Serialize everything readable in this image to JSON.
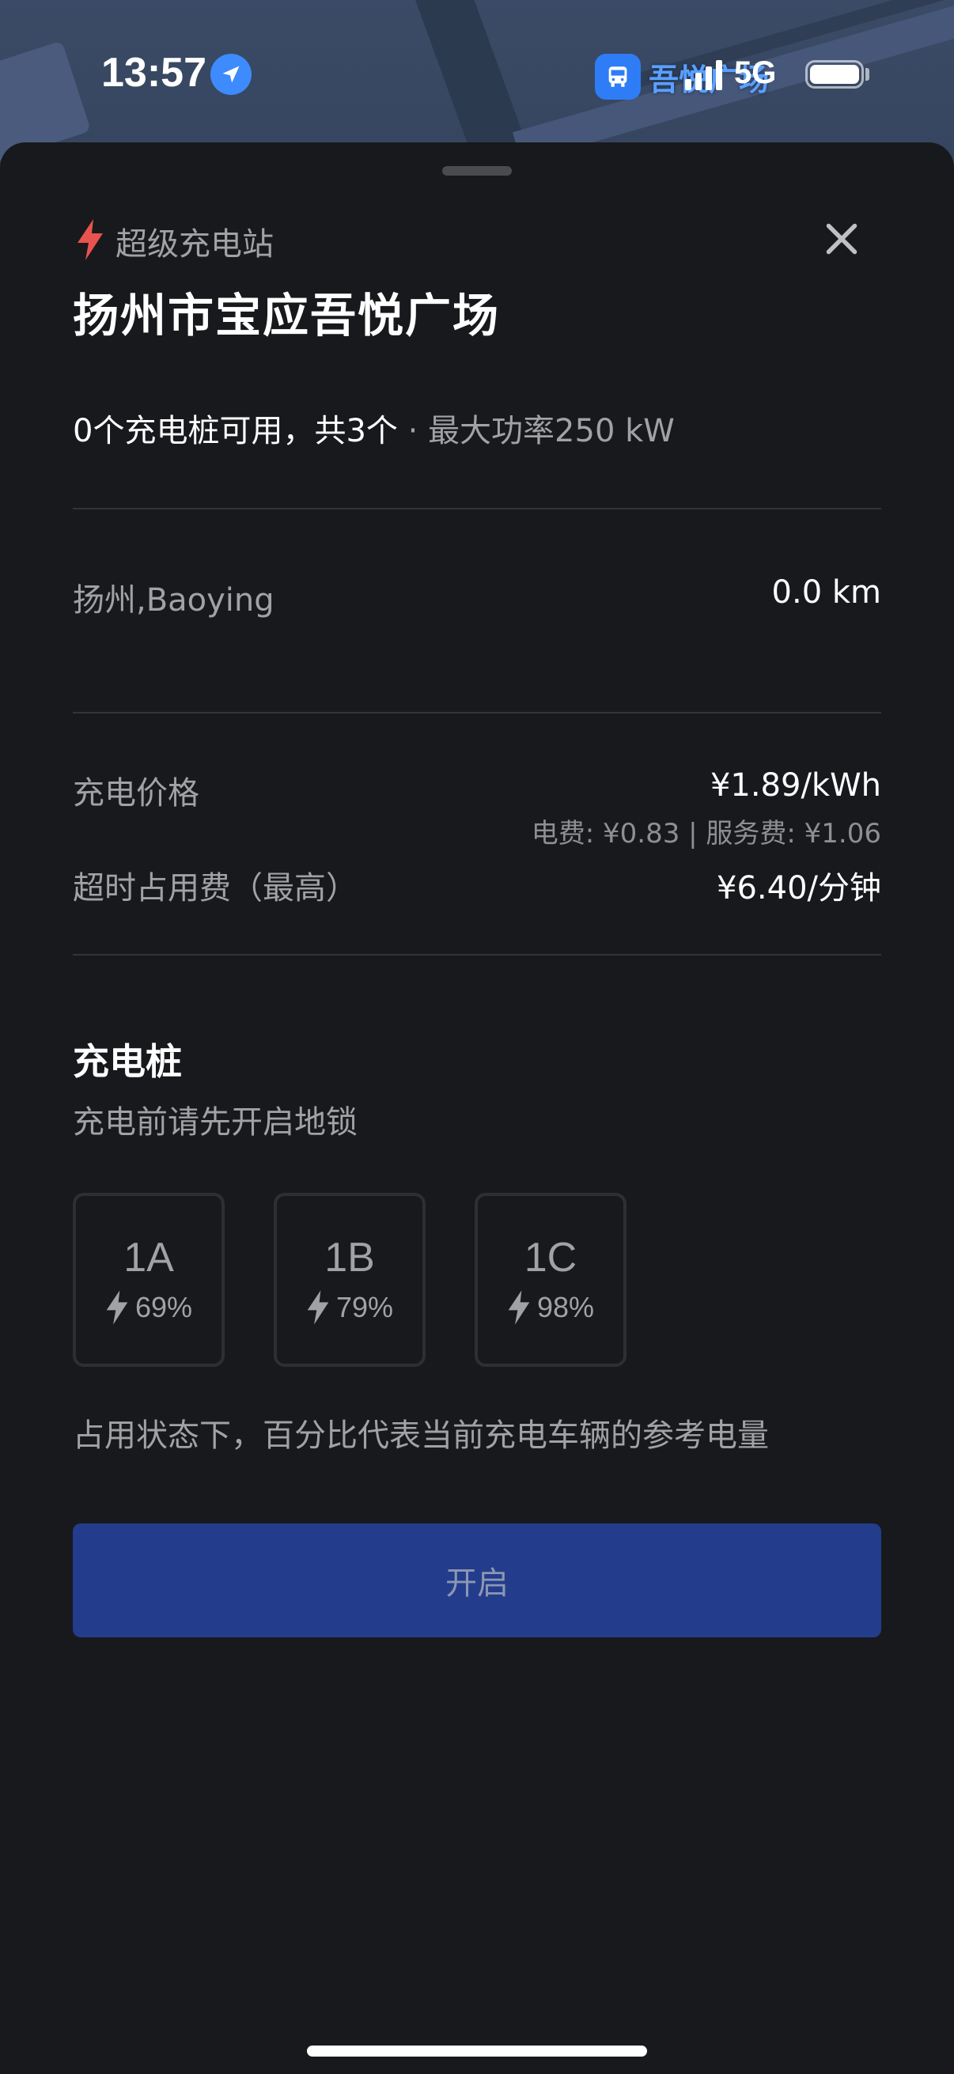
{
  "status_bar": {
    "time": "13:57",
    "network": "5G",
    "map_poi_label": "吾悦广场"
  },
  "colors": {
    "accent_red": "#e8534f",
    "button_blue": "#233d8c",
    "sheet_bg": "#18191c"
  },
  "station": {
    "type_label": "超级充电站",
    "type_icon": "lightning-bolt-icon",
    "name": "扬州市宝应吾悦广场",
    "availability": "0个充电桩可用，共3个",
    "separator": " · ",
    "max_power": "最大功率250 kW"
  },
  "location": {
    "label": "扬州,Baoying",
    "distance": "0.0 km"
  },
  "pricing": {
    "charge_label": "充电价格",
    "charge_value": "¥1.89/kWh",
    "charge_breakdown": "电费: ¥0.83 | 服务费: ¥1.06",
    "idle_label": "超时占用费（最高）",
    "idle_value": "¥6.40/分钟"
  },
  "stalls_section": {
    "title": "充电桩",
    "subtitle": "充电前请先开启地锁",
    "stalls": [
      {
        "id": "1A",
        "percent": "69%"
      },
      {
        "id": "1B",
        "percent": "79%"
      },
      {
        "id": "1C",
        "percent": "98%"
      }
    ],
    "note": "占用状态下，百分比代表当前充电车辆的参考电量"
  },
  "action": {
    "button_label": "开启"
  }
}
